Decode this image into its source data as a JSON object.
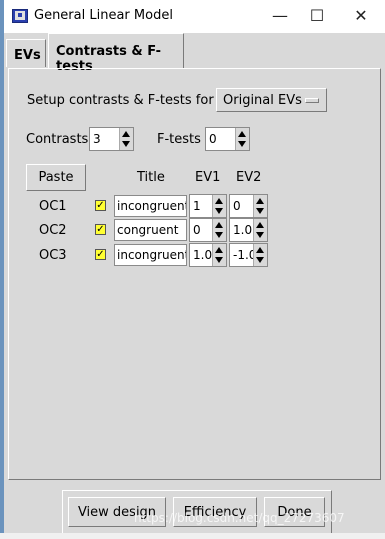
{
  "window": {
    "title": "General Linear Model"
  },
  "tabs": [
    {
      "label": "EVs"
    },
    {
      "label": "Contrasts & F-tests"
    }
  ],
  "setup": {
    "label": "Setup contrasts & F-tests for",
    "selected": "Original EVs"
  },
  "counts": {
    "contrasts_label": "Contrasts",
    "contrasts_value": "3",
    "ftests_label": "F-tests",
    "ftests_value": "0"
  },
  "table": {
    "paste_label": "Paste",
    "headers": {
      "title": "Title",
      "ev1": "EV1",
      "ev2": "EV2"
    },
    "rows": [
      {
        "label": "OC1",
        "checked": true,
        "title": "incongruent",
        "ev1": "1",
        "ev2": "0"
      },
      {
        "label": "OC2",
        "checked": true,
        "title": "congruent",
        "ev1": "0",
        "ev2": "1.0"
      },
      {
        "label": "OC3",
        "checked": true,
        "title": "incongruent-",
        "ev1": "1.0",
        "ev2": "-1.0"
      }
    ]
  },
  "buttons": {
    "view_design": "View design",
    "efficiency": "Efficiency",
    "done": "Done"
  },
  "watermark": "https://blog.csdn.net/qq_27273607",
  "colors": {
    "checkbox": "#ffff33",
    "panel": "#d9d9d9"
  }
}
